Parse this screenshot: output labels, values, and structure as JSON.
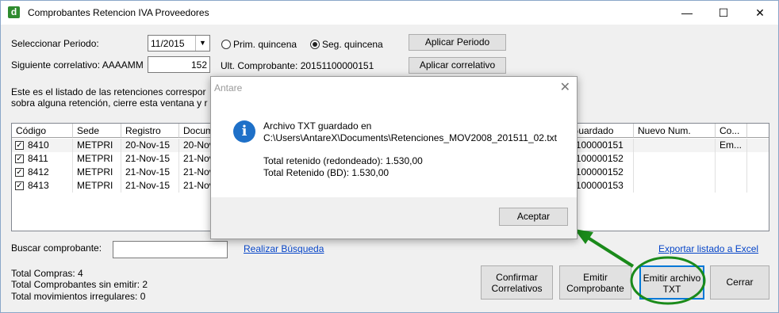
{
  "window": {
    "title": "Comprobantes Retencion IVA Proveedores",
    "app_icon_letter": "d",
    "minimize_glyph": "—",
    "maximize_glyph": "☐",
    "close_glyph": "✕"
  },
  "periodo": {
    "label": "Seleccionar Periodo:",
    "value": "11/2015",
    "radio_first": "Prim. quincena",
    "radio_second": "Seg. quincena",
    "selected": "Seg. quincena",
    "apply_button": "Aplicar Periodo"
  },
  "correlativo": {
    "label": "Siguiente correlativo: AAAAMM",
    "value": "152",
    "last_label": "Ult. Comprobante: 20151100000151",
    "apply_button": "Aplicar correlativo"
  },
  "description": {
    "line1": "Este es el listado de las retenciones correspor",
    "line2": "sobra alguna retención, cierre esta ventana y r"
  },
  "grid": {
    "columns": [
      "Código",
      "Sede",
      "Registro",
      "Docum",
      "Guardado",
      "Nuevo Num.",
      "Co..."
    ],
    "rows": [
      {
        "codigo": "8410",
        "sede": "METPRI",
        "registro": "20-Nov-15",
        "documento": "20-Nov",
        "guardado": "1100000151",
        "nuevo": "",
        "co": "Em...",
        "checked": true
      },
      {
        "codigo": "8411",
        "sede": "METPRI",
        "registro": "21-Nov-15",
        "documento": "21-Nov",
        "guardado": "1100000152",
        "nuevo": "",
        "co": "",
        "checked": true
      },
      {
        "codigo": "8412",
        "sede": "METPRI",
        "registro": "21-Nov-15",
        "documento": "21-Nov",
        "guardado": "1100000152",
        "nuevo": "",
        "co": "",
        "checked": true
      },
      {
        "codigo": "8413",
        "sede": "METPRI",
        "registro": "21-Nov-15",
        "documento": "21-Nov",
        "guardado": "1100000153",
        "nuevo": "",
        "co": "",
        "checked": true
      }
    ]
  },
  "search": {
    "label": "Buscar comprobante:",
    "value": "",
    "link": "Realizar Búsqueda"
  },
  "export_link": "Exportar listado a Excel",
  "totals": {
    "compras": "Total Compras: 4",
    "sin_emitir": "Total Comprobantes sin emitir: 2",
    "irregulares": "Total movimientos irregulares: 0"
  },
  "buttons": {
    "confirmar_line1": "Confirmar",
    "confirmar_line2": "Correlativos",
    "emitir_line1": "Emitir",
    "emitir_line2": "Comprobante",
    "txt_line1": "Emitir archivo",
    "txt_line2": "TXT",
    "cerrar": "Cerrar"
  },
  "dialog": {
    "title": "Antare",
    "close_glyph": "✕",
    "message_line1": "Archivo TXT guardado en",
    "message_line2": "C:\\Users\\AntareX\\Documents\\Retenciones_MOV2008_201511_02.txt",
    "total_redondeado": "Total retenido (redondeado): 1.530,00",
    "total_bd": "Total Retenido (BD): 1.530,00",
    "ok_button": "Aceptar",
    "icon": "info-icon"
  },
  "annotation_color": "#1a8a1a"
}
